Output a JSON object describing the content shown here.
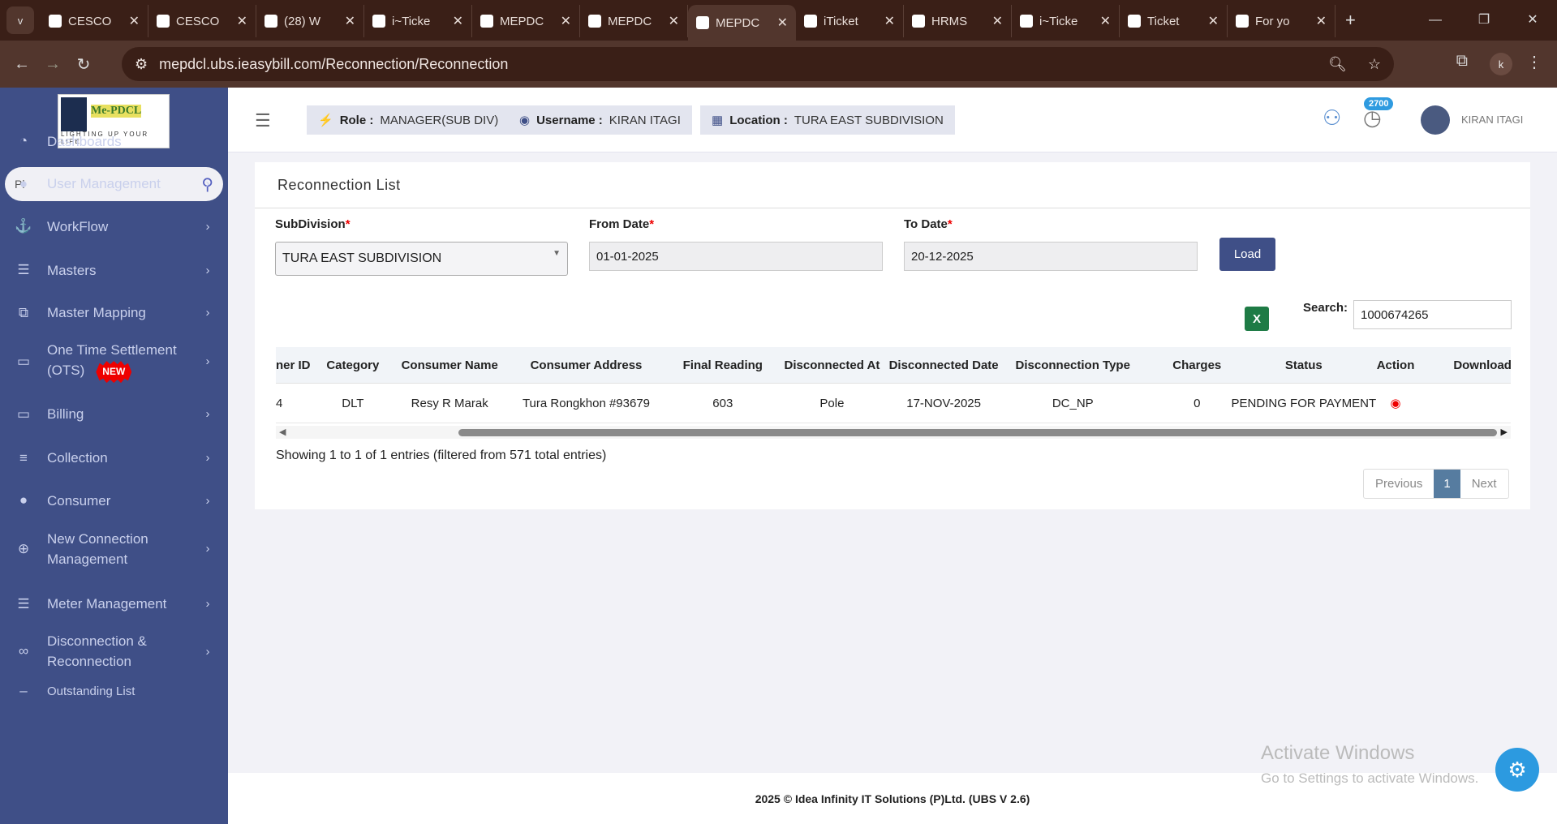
{
  "browser": {
    "tabs": [
      {
        "title": "CESCO"
      },
      {
        "title": "CESCO"
      },
      {
        "title": "(28) W",
        "badge": "28"
      },
      {
        "title": "i~Ticke"
      },
      {
        "title": "MEPDC"
      },
      {
        "title": "MEPDC"
      },
      {
        "title": "MEPDC",
        "active": true
      },
      {
        "title": "iTicket"
      },
      {
        "title": "HRMS"
      },
      {
        "title": "i~Ticke"
      },
      {
        "title": "Ticket"
      },
      {
        "title": "For yo"
      }
    ],
    "url": "mepdcl.ubs.ieasybill.com/Reconnection/Reconnection",
    "profile_initial": "k"
  },
  "sidebar": {
    "logo_text": "Me-PDCL",
    "logo_tagline": "LIGHTING UP YOUR LIFE",
    "search_value": "Pl",
    "items": [
      {
        "label": "Dashboards",
        "icon": "dashboard-icon"
      },
      {
        "label": "User Management",
        "icon": "user-icon"
      },
      {
        "label": "WorkFlow",
        "icon": "anchor-icon"
      },
      {
        "label": "Masters",
        "icon": "list-icon"
      },
      {
        "label": "Master Mapping",
        "icon": "sitemap-icon"
      },
      {
        "label": "One Time Settlement (OTS)",
        "badge": "NEW",
        "icon": "monitor-icon"
      },
      {
        "label": "Billing",
        "icon": "monitor-icon"
      },
      {
        "label": "Collection",
        "icon": "ordered-list-icon"
      },
      {
        "label": "Consumer",
        "icon": "user-icon"
      },
      {
        "label": "New Connection Management",
        "icon": "plus-circle-icon"
      },
      {
        "label": "Meter Management",
        "icon": "list-icon"
      },
      {
        "label": "Disconnection & Reconnection",
        "icon": "link-icon"
      },
      {
        "label": "Outstanding List",
        "icon": "dash-icon"
      }
    ]
  },
  "header": {
    "role_label": "Role :",
    "role": "MANAGER(SUB DIV)",
    "username_label": "Username :",
    "username": "KIRAN ITAGI",
    "location_label": "Location :",
    "location": "TURA EAST SUBDIVISION",
    "notif_count": "2700",
    "user": "KIRAN ITAGI"
  },
  "page": {
    "title": "Reconnection List",
    "filters": {
      "subdivision_label": "SubDivision",
      "subdivision": "TURA EAST SUBDIVISION",
      "from_label": "From Date",
      "from": "01-01-2025",
      "to_label": "To Date",
      "to": "20-12-2025",
      "load": "Load"
    },
    "search_label": "Search:",
    "search_value": "1000674265",
    "table": {
      "columns": [
        "ner ID",
        "Category",
        "Consumer Name",
        "Consumer Address",
        "Final Reading",
        "Disconnected At",
        "Disconnected Date",
        "Disconnection Type",
        "Charges",
        "Status",
        "Action",
        "Download"
      ],
      "rows": [
        [
          "4",
          "DLT",
          "Resy R Marak",
          "Tura Rongkhon #93679",
          "603",
          "Pole",
          "17-NOV-2025",
          "DC_NP",
          "0",
          "PENDING FOR PAYMENT",
          "",
          ""
        ]
      ]
    },
    "info": "Showing 1 to 1 of 1 entries (filtered from 571 total entries)",
    "pager": {
      "prev": "Previous",
      "current": "1",
      "next": "Next"
    }
  },
  "footer": "2025 © Idea Infinity IT Solutions (P)Ltd. (UBS V 2.6)",
  "watermark": {
    "line1": "Activate Windows",
    "line2": "Go to Settings to activate Windows."
  }
}
